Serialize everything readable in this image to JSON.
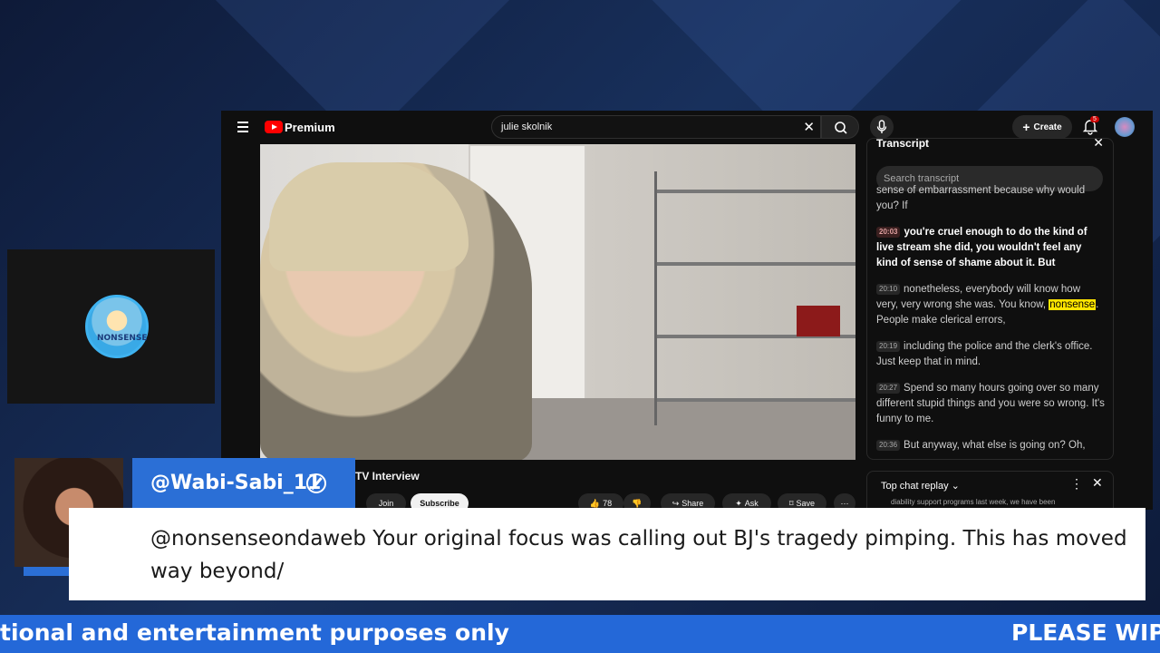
{
  "youtube": {
    "brand": "Premium",
    "search_query": "julie skolnik",
    "create_label": "Create",
    "notification_count": "5",
    "video_title_fragment": "TV Interview",
    "buttons": {
      "join": "Join",
      "subscribe": "Subscribe",
      "like_count": "78",
      "share": "Share",
      "ask": "Ask",
      "save": "Save"
    },
    "transcript": {
      "title": "Transcript",
      "search_placeholder": "Search transcript",
      "segments": [
        {
          "time": "",
          "text": "sense of embarrassment because why would you? If"
        },
        {
          "time": "20:03",
          "text": "you're cruel enough to do the kind of live stream she did, you wouldn't feel any kind of sense of shame about it. But"
        },
        {
          "time": "20:10",
          "text_before": "nonetheless, everybody will know how very, very wrong she was. You know,",
          "highlight": "nonsense",
          "text_after": ". People make clerical errors,"
        },
        {
          "time": "20:19",
          "text": "including the police and the clerk's office. Just keep that in mind."
        },
        {
          "time": "20:27",
          "text": "Spend so many hours going over so many different stupid things and you were so wrong. It's funny to me."
        },
        {
          "time": "20:36",
          "text": "But anyway, what else is going on? Oh,"
        }
      ]
    },
    "chat": {
      "title": "Top chat replay",
      "preview": "diability support programs last week, we have been"
    }
  },
  "comment": {
    "username": "@Wabi-Sabi_11",
    "text": "@nonsenseondaweb Your original focus was calling out BJ's tragedy pimping. This has moved way beyond/"
  },
  "channel_logo_text": "NONSENSE",
  "ticker": {
    "left_text": "tional and entertainment purposes only",
    "right_text": "PLEASE WIPE"
  }
}
